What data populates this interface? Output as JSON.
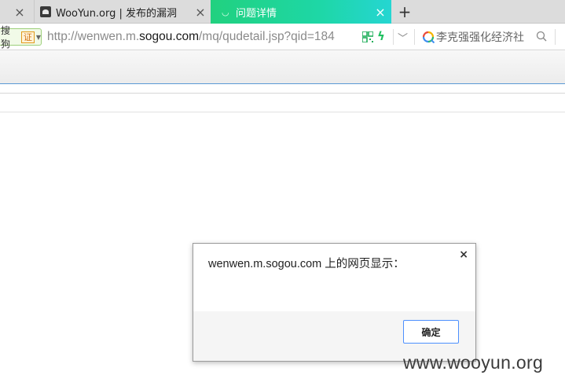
{
  "tabs": [
    {
      "label": "",
      "close_icon": "×"
    },
    {
      "label": "WooYun.org | 发布的漏洞",
      "close_icon": "×"
    },
    {
      "label": "问题详情",
      "close_icon": "×",
      "active": true,
      "accent": "#21d17f"
    }
  ],
  "new_tab_icon": "+",
  "address": {
    "site_badge": "搜狗",
    "cert_badge": "证",
    "url_prefix": "http://wenwen.m.",
    "url_domain": "sogou.com",
    "url_path": "/mq/qudetail.jsp?qid=184",
    "search_value": "李克强强化经济社"
  },
  "dialog": {
    "title": "wenwen.m.sogou.com 上的网页显示：",
    "close_icon": "×",
    "ok_label": "确定"
  },
  "watermark": "www.wooyun.org"
}
